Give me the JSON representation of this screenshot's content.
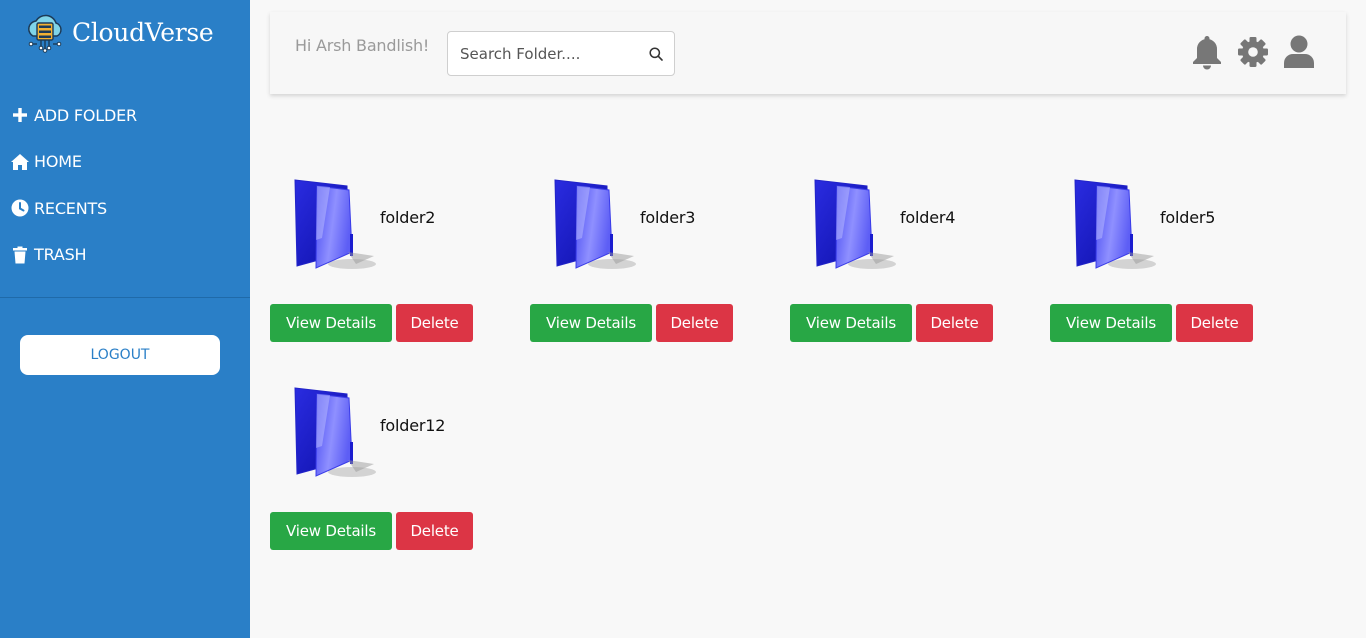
{
  "brand": {
    "name": "CloudVerse"
  },
  "sidebar": {
    "items": [
      {
        "label": "ADD FOLDER",
        "icon": "plus-icon"
      },
      {
        "label": "HOME",
        "icon": "home-icon"
      },
      {
        "label": "RECENTS",
        "icon": "clock-icon"
      },
      {
        "label": "TRASH",
        "icon": "trash-icon"
      }
    ],
    "logout_label": "LOGOUT"
  },
  "header": {
    "greeting": "Hi Arsh Bandlish!",
    "search_placeholder": "Search Folder....",
    "icons": [
      "bell-icon",
      "gear-icon",
      "user-icon"
    ]
  },
  "folders": [
    {
      "name": "folder2",
      "view_label": "View Details",
      "delete_label": "Delete"
    },
    {
      "name": "folder3",
      "view_label": "View Details",
      "delete_label": "Delete"
    },
    {
      "name": "folder4",
      "view_label": "View Details",
      "delete_label": "Delete"
    },
    {
      "name": "folder5",
      "view_label": "View Details",
      "delete_label": "Delete"
    },
    {
      "name": "folder12",
      "view_label": "View Details",
      "delete_label": "Delete"
    }
  ],
  "colors": {
    "sidebar": "#2a7fc7",
    "view_button": "#28a745",
    "delete_button": "#dc3545",
    "header_icons": "#777777"
  }
}
